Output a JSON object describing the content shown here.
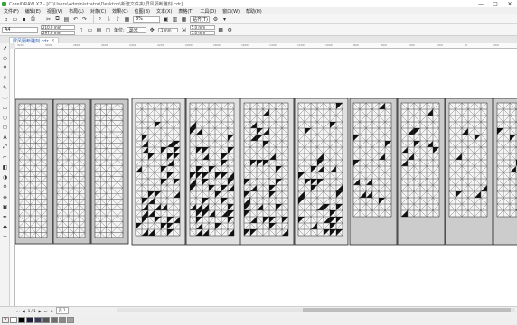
{
  "window": {
    "title": "CorelDRAW X7 - [C:\\Users\\Administrator\\Desktop\\新建文件夹\\屏风隔断雕刻.cdr]",
    "controls": [
      "—",
      "□",
      "✕"
    ]
  },
  "menubar": [
    "文件(F)",
    "编辑(E)",
    "视图(V)",
    "布局(L)",
    "对象(C)",
    "效果(C)",
    "位图(B)",
    "文本(X)",
    "表格(T)",
    "工具(O)",
    "窗口(W)",
    "帮助(H)"
  ],
  "toolbar1": {
    "zoom": "8%",
    "snap_label": "贴齐(T)"
  },
  "toolbar2": {
    "paper_size": "A4",
    "width": "210.0 mm",
    "height": "297.0 mm",
    "units_label": "单位:",
    "units": "毫米",
    "nudge": ".1 mm",
    "dup_x": "5.0 mm",
    "dup_y": "5.0 mm"
  },
  "doc_tab": {
    "label": "屏风隔断雕刻.cdr"
  },
  "ruler": {
    "ticks": [
      "3200",
      "3000",
      "2800",
      "2600",
      "2400",
      "2200",
      "2000",
      "1800",
      "1600",
      "1400",
      "1200",
      "1000",
      "800",
      "600",
      "400",
      "200",
      "0",
      "200"
    ]
  },
  "pagenav": {
    "current": "1 / 1",
    "page_label": "页 1"
  },
  "palette": {
    "colors": [
      "#ffffff",
      "#000000",
      "#1a1a3a",
      "#3a3a5a",
      "#555555",
      "#6e6e6e",
      "#888888",
      "#a0a0a0"
    ]
  },
  "panels": [
    {
      "group": "A",
      "count": 3,
      "bg": "#c8c8c8",
      "motif": "lattice"
    },
    {
      "group": "B",
      "count": 4,
      "bg": "#e0e0e0",
      "motif": "dense-triangles"
    },
    {
      "group": "C",
      "count": 4,
      "bg": "#cccccc",
      "motif": "sparse-triangles"
    }
  ]
}
